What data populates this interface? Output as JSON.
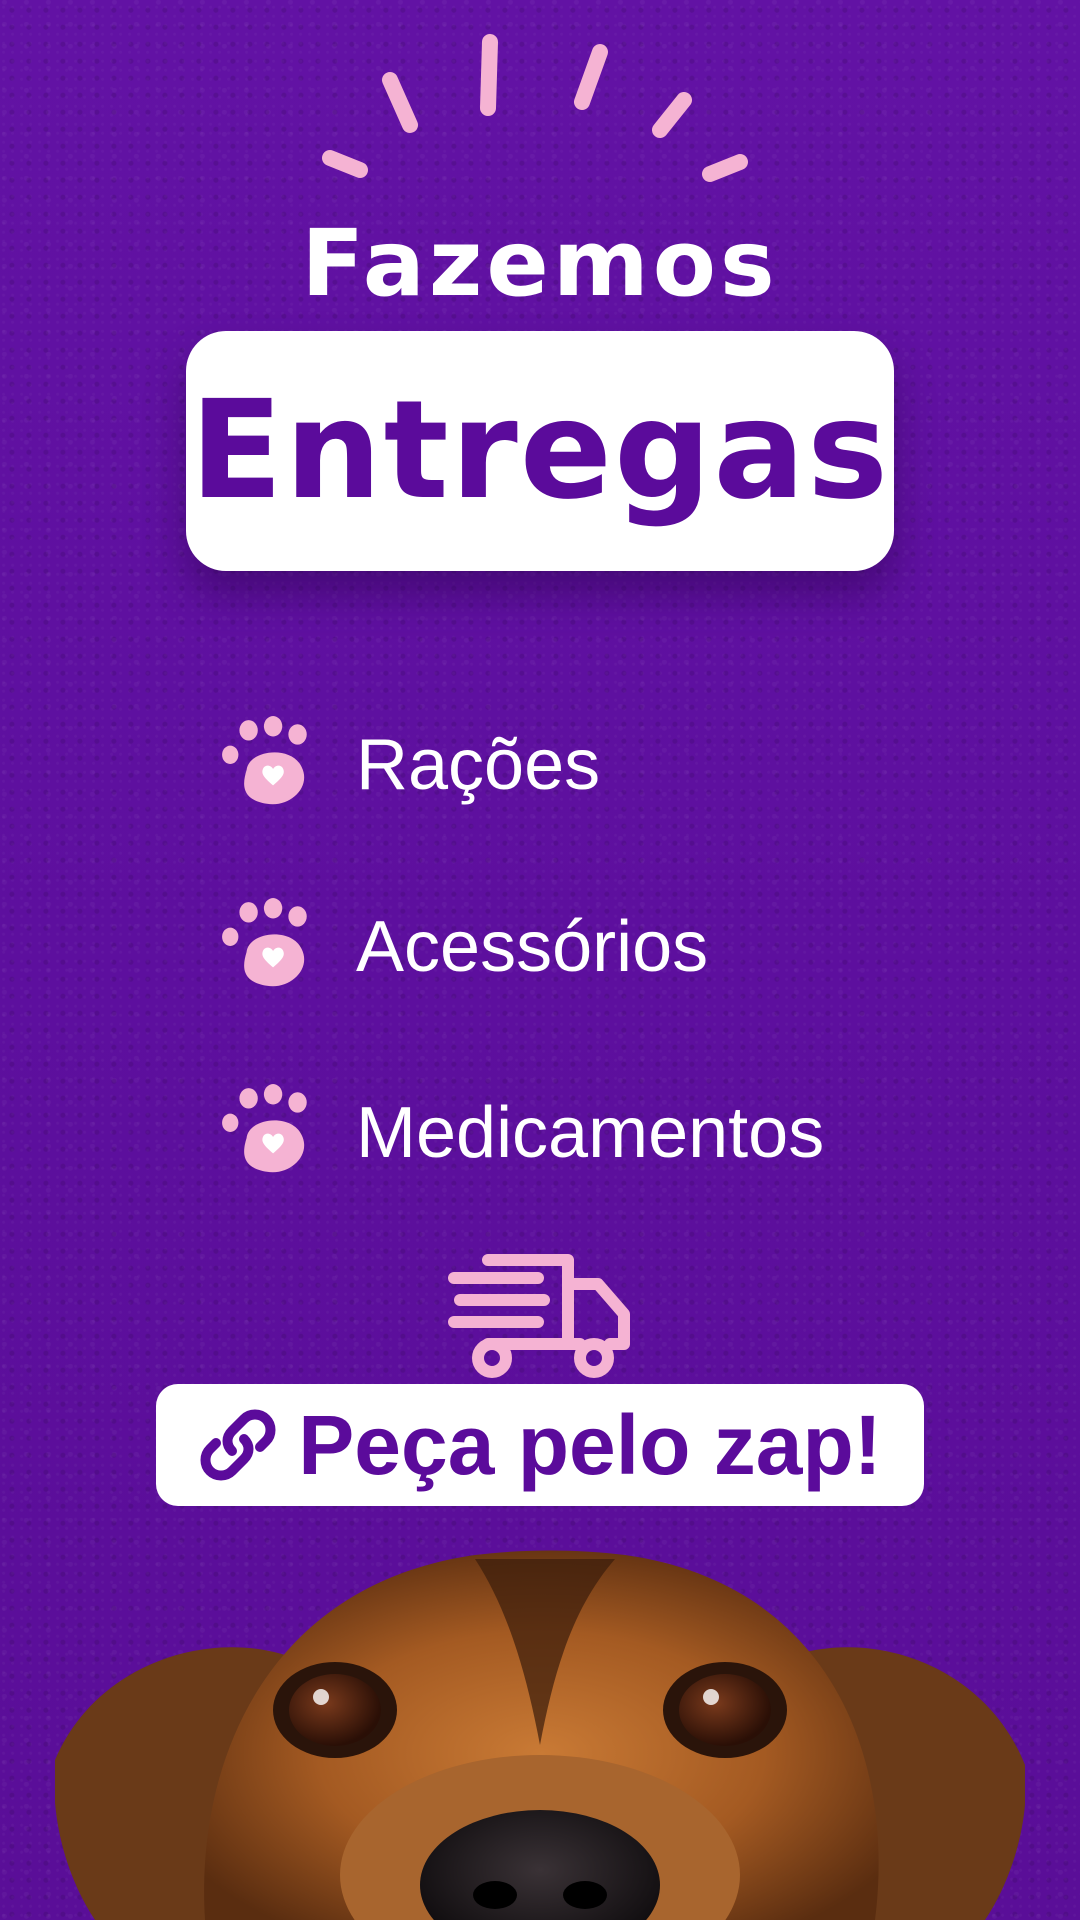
{
  "header": {
    "subtitle": "Fazemos",
    "title": "Entregas"
  },
  "services": [
    {
      "label": "Rações",
      "icon": "paw-heart-icon"
    },
    {
      "label": "Acessórios",
      "icon": "paw-heart-icon"
    },
    {
      "label": "Medicamentos",
      "icon": "paw-heart-icon"
    }
  ],
  "cta": {
    "label": "Peça pelo zap!",
    "icon": "link-icon"
  },
  "colors": {
    "background": "#5e0f9f",
    "accent_pink": "#f5b3d3",
    "title_purple": "#5b0b9b",
    "white": "#ffffff"
  }
}
